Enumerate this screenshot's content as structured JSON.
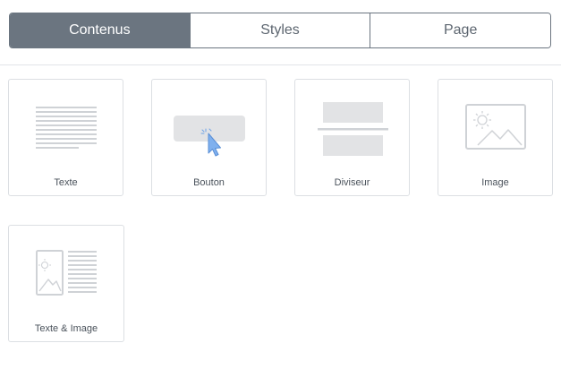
{
  "tabs": [
    {
      "label": "Contenus",
      "active": true
    },
    {
      "label": "Styles",
      "active": false
    },
    {
      "label": "Page",
      "active": false
    }
  ],
  "blocks": [
    {
      "label": "Texte",
      "icon": "text-block-icon"
    },
    {
      "label": "Bouton",
      "icon": "button-block-icon"
    },
    {
      "label": "Diviseur",
      "icon": "divider-block-icon"
    },
    {
      "label": "Image",
      "icon": "image-block-icon"
    },
    {
      "label": "Texte & Image",
      "icon": "text-image-block-icon"
    }
  ],
  "colors": {
    "active_tab": "#6b7580",
    "icon_gray": "#cfd2d6",
    "cursor_blue": "#6fa3e6"
  }
}
